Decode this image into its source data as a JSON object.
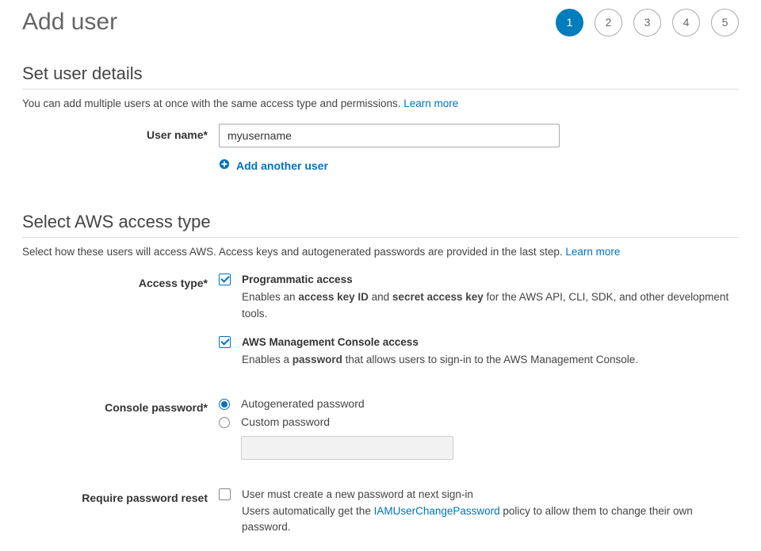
{
  "page": {
    "title": "Add user",
    "steps": [
      "1",
      "2",
      "3",
      "4",
      "5"
    ],
    "active_step": 0
  },
  "section_user_details": {
    "heading": "Set user details",
    "desc": "You can add multiple users at once with the same access type and permissions. ",
    "learn_more": "Learn more"
  },
  "user_name": {
    "label": "User name*",
    "value": "myusername"
  },
  "add_another": {
    "label": "Add another user"
  },
  "section_access_type": {
    "heading": "Select AWS access type",
    "desc": "Select how these users will access AWS. Access keys and autogenerated passwords are provided in the last step. ",
    "learn_more": "Learn more"
  },
  "access_type": {
    "label": "Access type*",
    "programmatic": {
      "title": "Programmatic access",
      "desc_pre": "Enables an ",
      "bold1": "access key ID",
      "mid": " and ",
      "bold2": "secret access key",
      "desc_post": " for the AWS API, CLI, SDK, and other development tools."
    },
    "console": {
      "title": "AWS Management Console access",
      "desc_pre": "Enables a ",
      "bold1": "password",
      "desc_post": " that allows users to sign-in to the AWS Management Console."
    }
  },
  "console_password": {
    "label": "Console password*",
    "auto": "Autogenerated password",
    "custom": "Custom password"
  },
  "require_reset": {
    "label": "Require password reset",
    "line1": "User must create a new password at next sign-in",
    "line2_pre": "Users automatically get the ",
    "policy_link": "IAMUserChangePassword",
    "line2_post": " policy to allow them to change their own password."
  }
}
